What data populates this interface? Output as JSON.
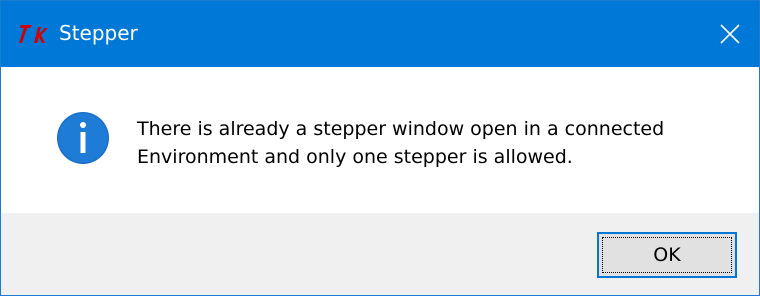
{
  "window": {
    "title": "Stepper",
    "app_icon": "tk-feather-icon",
    "close_icon": "close-icon",
    "accent_color": "#0078d7"
  },
  "message": {
    "icon": "info-icon",
    "line1": "There is already a stepper window open in a connected",
    "line2": "Environment and only one stepper is allowed."
  },
  "buttons": {
    "ok_label": "OK"
  }
}
